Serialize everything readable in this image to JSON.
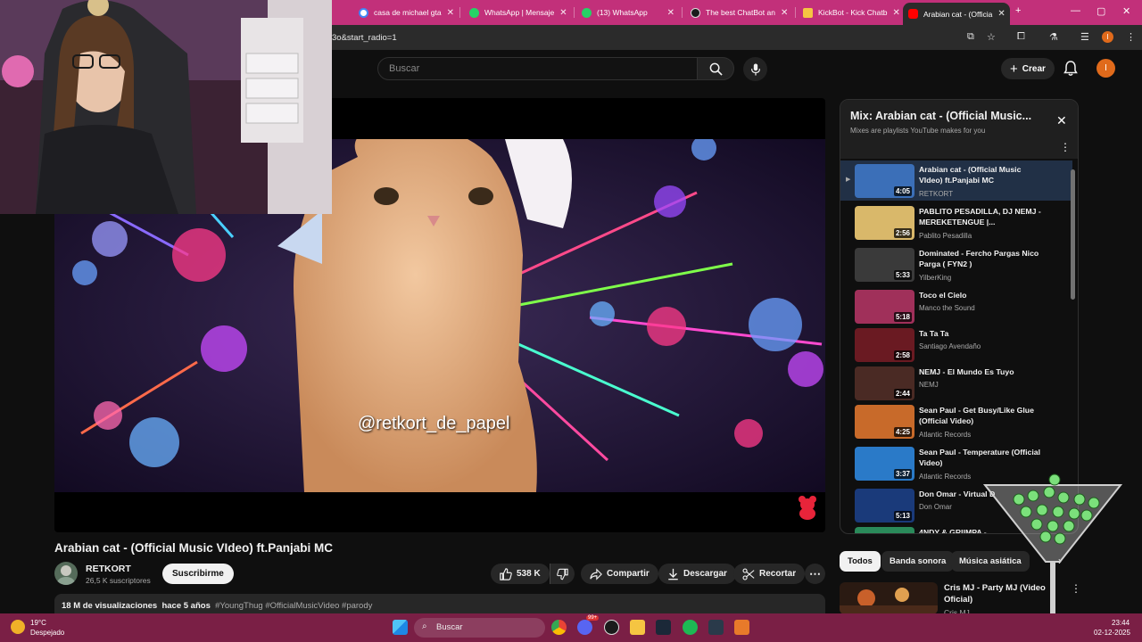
{
  "browser": {
    "tabs": [
      {
        "label": "casa de michael gta",
        "favicon": "google-icon",
        "color": "#4285f4"
      },
      {
        "label": "WhatsApp | Mensaje",
        "favicon": "whatsapp-icon",
        "color": "#25d366"
      },
      {
        "label": "(13) WhatsApp",
        "favicon": "whatsapp-icon",
        "color": "#25d366"
      },
      {
        "label": "The best ChatBot an",
        "favicon": "bot-icon",
        "color": "#1b1b1b"
      },
      {
        "label": "KickBot - Kick Chatb",
        "favicon": "kickbot-icon",
        "color": "#f5c542"
      },
      {
        "label": "Arabian cat - (Officia",
        "favicon": "youtube-icon",
        "color": "#ff0000"
      }
    ],
    "url": "3o&start_radio=1",
    "new_tab": "+"
  },
  "youtube": {
    "search_placeholder": "Buscar",
    "create_label": "Crear",
    "avatar_letter": "I",
    "watermark": "@retkort_de_papel",
    "video": {
      "title": "Arabian cat - (Official Music VIdeo) ft.Panjabi MC",
      "channel": "RETKORT",
      "subs": "26,5 K suscriptores",
      "subscribe": "Suscribirme",
      "likes": "538 K",
      "share": "Compartir",
      "download": "Descargar",
      "clip": "Recortar",
      "views": "18 M de visualizaciones",
      "age": "hace 5 años",
      "tags": "#YoungThug #OfficialMusicVideo #parody"
    },
    "playlist": {
      "title": "Mix: Arabian cat - (Official Music...",
      "subtitle": "Mixes are playlists YouTube makes for you",
      "items": [
        {
          "title": "Arabian cat - (Official Music VIdeo) ft.Panjabi MC",
          "channel": "RETKORT",
          "duration": "4:05",
          "thumb": "#3b6fb8"
        },
        {
          "title": "PABLITO PESADILLA, DJ NEMJ - MEREKETENGUE |...",
          "channel": "Pablito Pesadilla",
          "duration": "2:56",
          "thumb": "#d9b86a"
        },
        {
          "title": "Dominated - Fercho Pargas Nico Parga ( FYN2 )",
          "channel": "YilberKing",
          "duration": "5:33",
          "thumb": "#3a3a3a"
        },
        {
          "title": "Toco el Cielo",
          "channel": "Manco the Sound",
          "duration": "5:18",
          "thumb": "#a0305a"
        },
        {
          "title": "Ta Ta Ta",
          "channel": "Santiago Avendaño",
          "duration": "2:58",
          "thumb": "#6a1a22"
        },
        {
          "title": "NEMJ - El Mundo Es Tuyo",
          "channel": "NEMJ",
          "duration": "2:44",
          "thumb": "#4a2a24"
        },
        {
          "title": "Sean Paul - Get Busy/Like Glue (Official Video)",
          "channel": "Atlantic Records",
          "duration": "4:25",
          "thumb": "#c86a2a"
        },
        {
          "title": "Sean Paul - Temperature (Official Video)",
          "channel": "Atlantic Records",
          "duration": "3:37",
          "thumb": "#2a7ac8"
        },
        {
          "title": "Don Omar - Virtual D",
          "channel": "Don Omar",
          "duration": "5:13",
          "thumb": "#1a3a7a"
        },
        {
          "title": "4NDY & GRIIMPA -",
          "channel": "",
          "duration": "",
          "thumb": "#2a8a5a"
        }
      ]
    },
    "chips": [
      "Todos",
      "Banda sonora",
      "Música asiática"
    ],
    "recommendation": {
      "title": "Cris MJ - Party MJ (Video Oficial)",
      "channel": "Cris MJ"
    }
  },
  "taskbar": {
    "temp": "19°C",
    "weather": "Despejado",
    "search": "Buscar",
    "time": "23:44",
    "date": "02-12-2025",
    "badge": "99+"
  }
}
